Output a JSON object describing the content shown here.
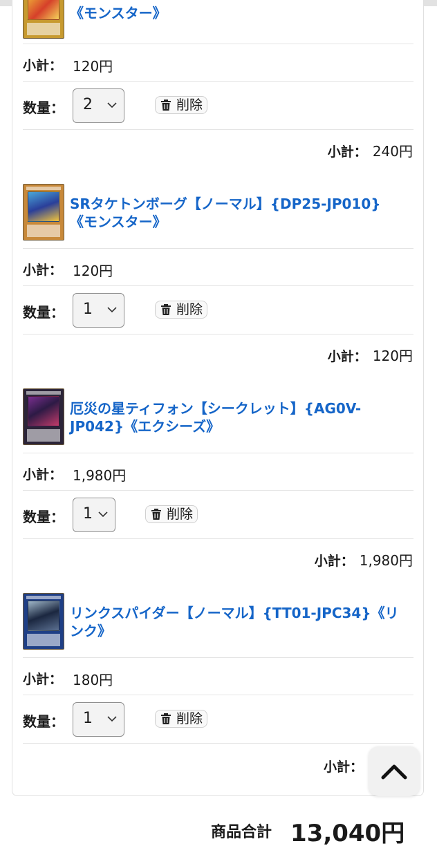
{
  "colors": {
    "link": "#1565c8",
    "text": "#1a1a1a",
    "divider": "#e4e4e4"
  },
  "labels": {
    "subtotal": "小計：",
    "quantity": "数量：",
    "delete": "削除"
  },
  "items": [
    {
      "title": "《モンスター》",
      "subtotal": "120円",
      "quantity": "2",
      "line_total": "240円",
      "card_image": "yellow-monster-card",
      "card_color": "#c79a2f"
    },
    {
      "title": "SRタケトンボーグ【ノーマル】{DP25-JP010}《モンスター》",
      "subtotal": "120円",
      "quantity": "1",
      "line_total": "120円",
      "card_image": "orange-monster-card",
      "card_color": "#c8893a"
    },
    {
      "title": "厄災の星ティフォン【シークレット】{AG0V-JP042}《エクシーズ》",
      "subtotal": "1,980円",
      "quantity": "1",
      "line_total": "1,980円",
      "card_image": "xyz-card",
      "card_color": "#2b2438"
    },
    {
      "title": "リンクスパイダー【ノーマル】{TT01-JPC34}《リンク》",
      "subtotal": "180円",
      "quantity": "1",
      "line_total": "",
      "card_image": "link-card",
      "card_color": "#1f3f86"
    }
  ],
  "summary": {
    "label": "商品合計",
    "total": "13,040円"
  },
  "scroll_top": {
    "icon": "chevron-up-icon"
  }
}
